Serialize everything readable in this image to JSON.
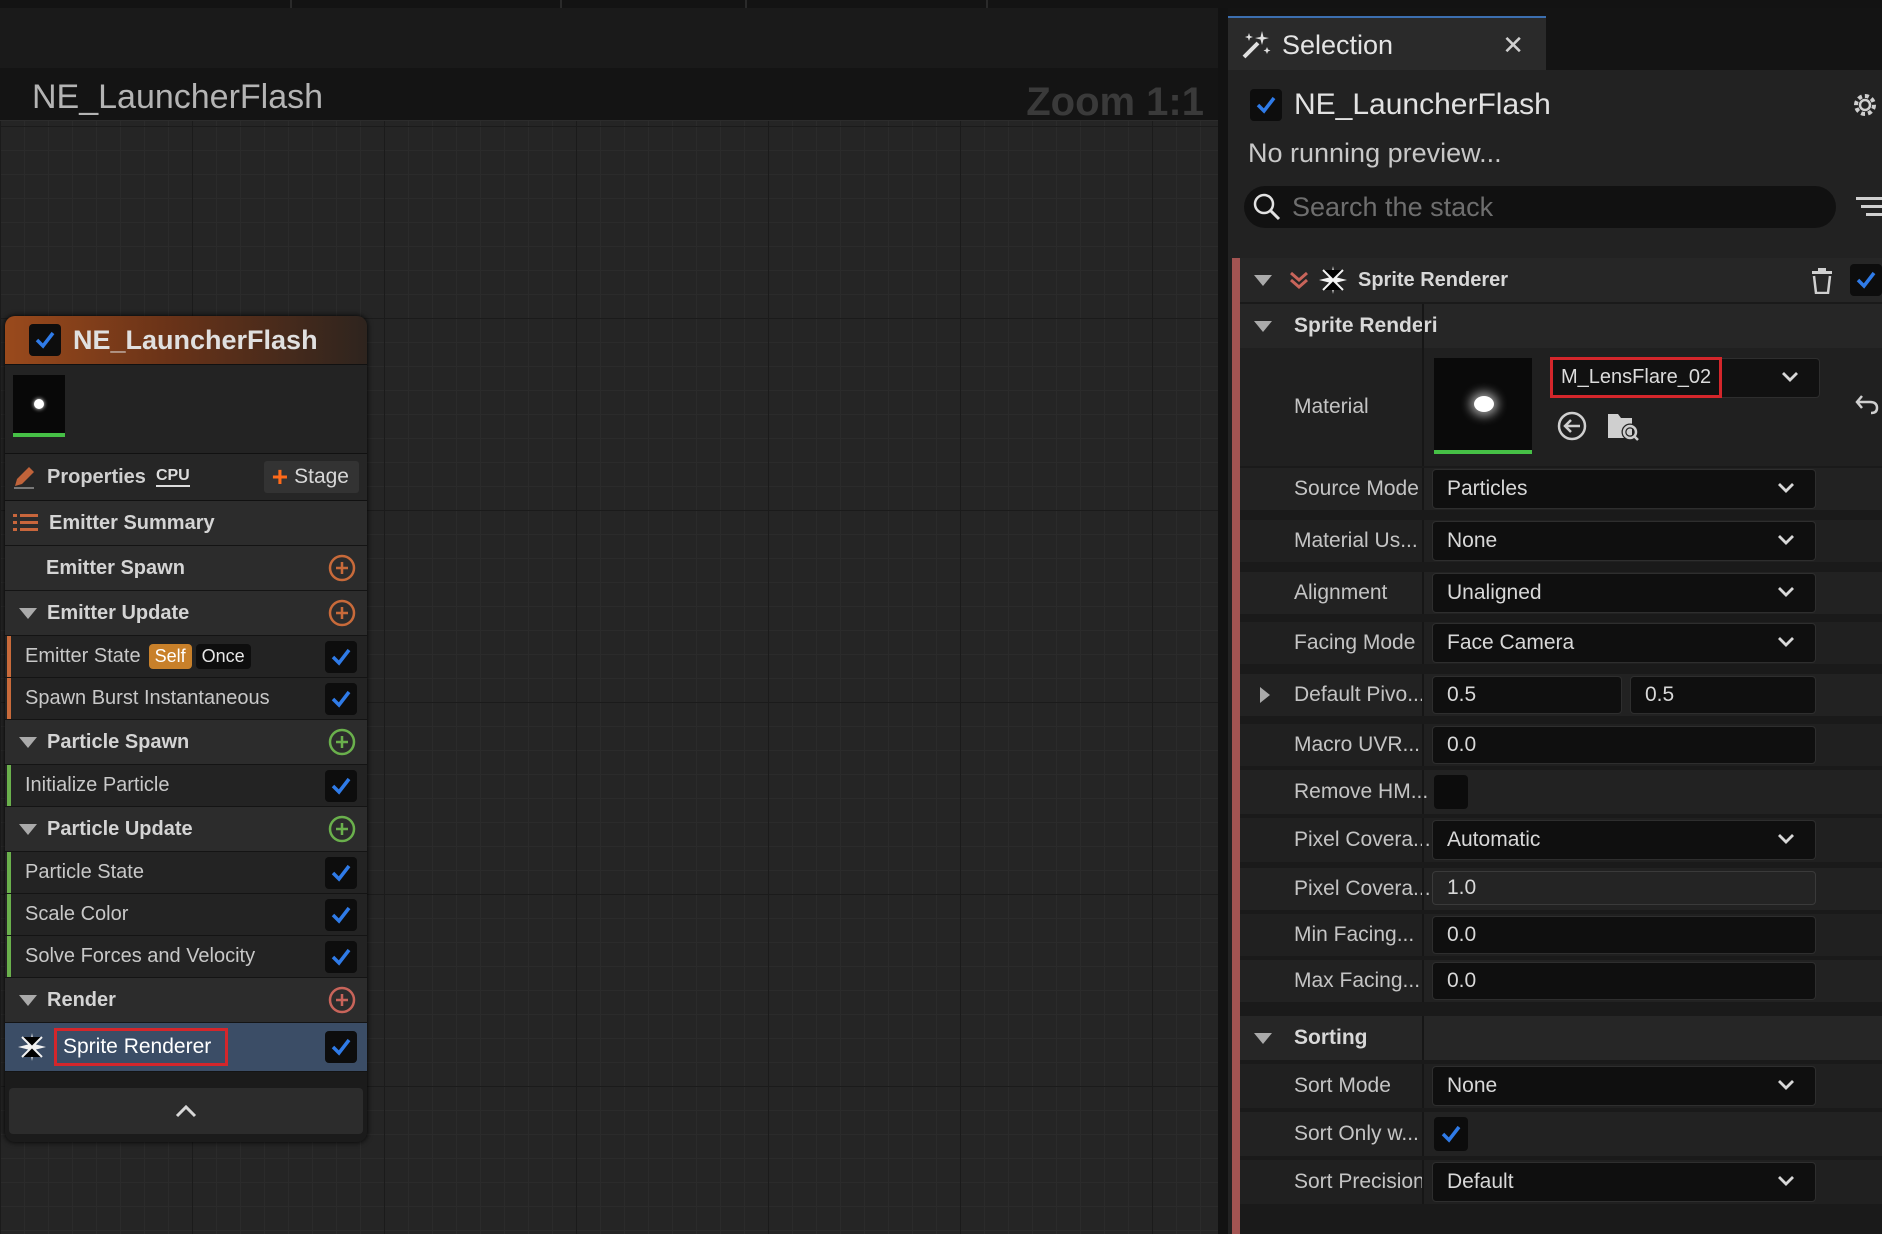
{
  "graph": {
    "title": "NE_LauncherFlash",
    "zoom": "Zoom 1:1"
  },
  "node": {
    "title": "NE_LauncherFlash",
    "properties_label": "Properties",
    "cpu_label": "CPU",
    "stage_label": "Stage",
    "emitter_summary": "Emitter Summary",
    "emitter_spawn": "Emitter Spawn",
    "emitter_update": "Emitter Update",
    "emitter_state": "Emitter State",
    "chip_self": "Self",
    "chip_once": "Once",
    "spawn_burst": "Spawn Burst Instantaneous",
    "particle_spawn": "Particle Spawn",
    "initialize_particle": "Initialize Particle",
    "particle_update": "Particle Update",
    "particle_state": "Particle State",
    "scale_color": "Scale Color",
    "solve_forces": "Solve Forces and Velocity",
    "render": "Render",
    "sprite_renderer": "Sprite Renderer"
  },
  "panel": {
    "tab_label": "Selection",
    "emitter_name": "NE_LauncherFlash",
    "preview_status": "No running preview...",
    "search_placeholder": "Search the stack",
    "sprite_renderer_header": "Sprite Renderer",
    "sprite_renderer_section": "Sprite Renderi",
    "material_label": "Material",
    "material_value": "M_LensFlare_02",
    "source_mode_label": "Source Mode",
    "source_mode_value": "Particles",
    "material_user_label": "Material Us...",
    "material_user_value": "None",
    "alignment_label": "Alignment",
    "alignment_value": "Unaligned",
    "facing_mode_label": "Facing Mode",
    "facing_mode_value": "Face Camera",
    "default_pivot_label": "Default Pivo...",
    "default_pivot_x": "0.5",
    "default_pivot_y": "0.5",
    "macro_uv_label": "Macro UVR...",
    "macro_uv_value": "0.0",
    "remove_hmd_label": "Remove HM...",
    "pixel_coverage_mode_label": "Pixel Covera...",
    "pixel_coverage_mode_value": "Automatic",
    "pixel_coverage_blend_label": "Pixel Covera...",
    "pixel_coverage_blend_value": "1.0",
    "min_facing_label": "Min Facing...",
    "min_facing_value": "0.0",
    "max_facing_label": "Max Facing...",
    "max_facing_value": "0.0",
    "sorting_section": "Sorting",
    "sort_mode_label": "Sort Mode",
    "sort_mode_value": "None",
    "sort_only_label": "Sort Only w...",
    "sort_precision_label": "Sort Precision",
    "sort_precision_value": "Default"
  },
  "colors": {
    "check_blue": "#2f7be8",
    "spawn_orange": "#c86a3a",
    "particle_green": "#6ab04c",
    "accent_red": "#d4262b"
  }
}
